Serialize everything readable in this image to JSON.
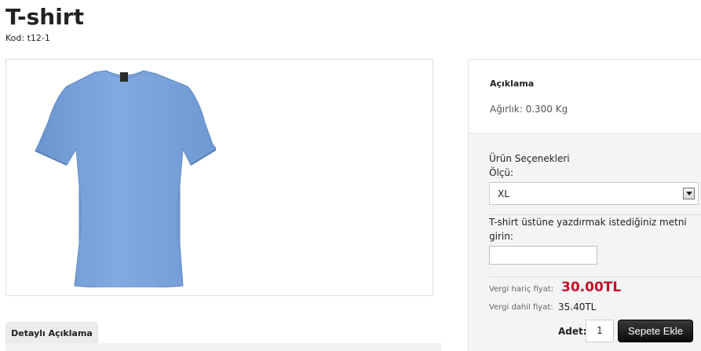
{
  "product": {
    "title": "T-shirt",
    "code": "Kod: t12-1",
    "image_color": "#7aa4dc"
  },
  "tabs": {
    "detail_label": "Detaylı Açıklama"
  },
  "description": {
    "heading": "Açıklama",
    "weight": "Ağırlık: 0.300 Kg"
  },
  "options": {
    "heading": "Ürün Seçenekleri",
    "size_label": "Ölçü:",
    "size_value": "XL",
    "print_label": "T-shirt üstüne yazdırmak istediğiniz metni girin:",
    "print_value": ""
  },
  "pricing": {
    "ex_tax_label": "Vergi hariç fiyat:",
    "ex_tax_value": "30.00TL",
    "inc_tax_label": "Vergi dahil fiyat:",
    "inc_tax_value": "35.40TL",
    "price_color": "#c0102a"
  },
  "cart": {
    "qty_label": "Adet:",
    "qty_value": "1",
    "add_button_label": "Sepete Ekle"
  }
}
